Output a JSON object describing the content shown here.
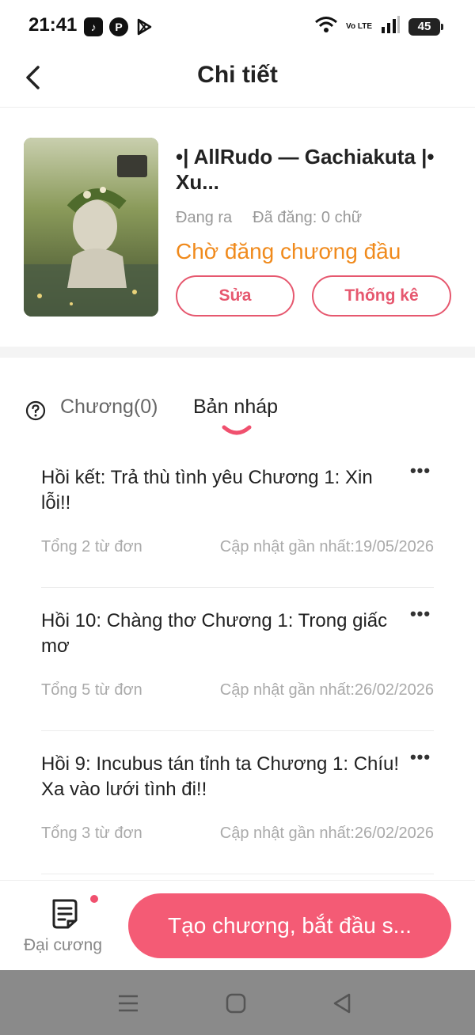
{
  "status_bar": {
    "time": "21:41",
    "apps": [
      "tiktok-icon",
      "pinterest-icon",
      "play-store-icon"
    ],
    "network": "Vo LTE",
    "battery": "45"
  },
  "header": {
    "title": "Chi tiết"
  },
  "book": {
    "title": "•| AllRudo — Gachiakuta |• Xu...",
    "status": "Đang ra",
    "posted": "Đã đăng: 0 chữ",
    "pending": "Chờ đăng chương đầu",
    "edit_label": "Sửa",
    "stats_label": "Thống kê"
  },
  "tabs": {
    "chapters": "Chương(0)",
    "drafts": "Bản nháp",
    "active": "drafts"
  },
  "drafts": [
    {
      "title": "Hồi kết: Trả thù tình yêu Chương 1: Xin lỗi!!",
      "words": "Tổng 2 từ đơn",
      "updated": "Cập nhật gần nhất:19/05/2026"
    },
    {
      "title": "Hồi 10: Chàng thơ Chương 1: Trong giấc mơ",
      "words": "Tổng 5 từ đơn",
      "updated": "Cập nhật gần nhất:26/02/2026"
    },
    {
      "title": "Hồi 9: Incubus tán tỉnh ta Chương 1: Chíu! Xa vào lưới tình đi!!",
      "words": "Tổng 3 từ đơn",
      "updated": "Cập nhật gần nhất:26/02/2026"
    }
  ],
  "bottom": {
    "outline_label": "Đại cương",
    "create_label": "Tạo chương, bắt đầu s..."
  },
  "colors": {
    "accent": "#f45b75",
    "pending": "#f08a1c"
  }
}
